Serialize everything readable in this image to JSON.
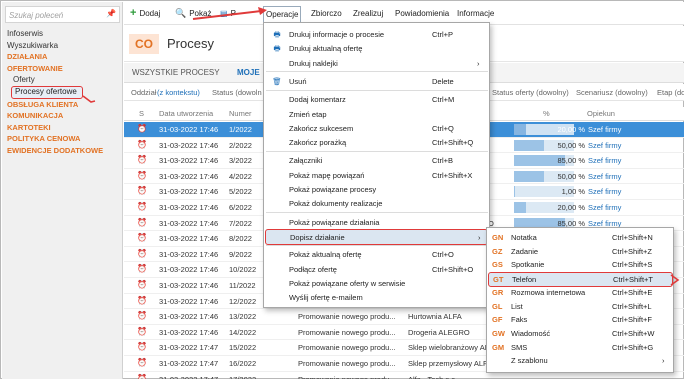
{
  "sidebar": {
    "search_placeholder": "Szukaj poleceń",
    "items": [
      {
        "label": "Infoserwis",
        "kind": "plain"
      },
      {
        "label": "Wyszukiwarka",
        "kind": "plain"
      },
      {
        "label": "DZIAŁANIA",
        "kind": "section"
      },
      {
        "label": "OFERTOWANIE",
        "kind": "section"
      },
      {
        "label": "Oferty",
        "kind": "sub"
      },
      {
        "label": "Procesy ofertowe",
        "kind": "active"
      },
      {
        "label": "OBSŁUGA KLIENTA",
        "kind": "section"
      },
      {
        "label": "KOMUNIKACJA",
        "kind": "section"
      },
      {
        "label": "KARTOTEKI",
        "kind": "section"
      },
      {
        "label": "POLITYKA CENOWA",
        "kind": "section"
      },
      {
        "label": "EWIDENCJE DODATKOWE",
        "kind": "section"
      }
    ]
  },
  "toolbar": {
    "add_label": "Dodaj",
    "show_label": "Pokaż",
    "partial_label": "P",
    "menus": [
      "Operacje",
      "Zbiorczo",
      "Zrealizuj",
      "Powiadomienia",
      "Informacje"
    ]
  },
  "header": {
    "badge": "CO",
    "title": "Procesy"
  },
  "tabs": {
    "all": "WSZYSTKIE PROCESY",
    "mine": "MOJE"
  },
  "filters": {
    "department": "Oddział",
    "context": "(z kontekstu)",
    "status": "Status (dowoln",
    "offer_status": "Status oferty (dowolny)",
    "scenario": "Scenariusz (dowolny)",
    "stage": "Etap (do"
  },
  "grid": {
    "columns": {
      "s": "S",
      "date": "Data utworzenia",
      "number": "Numer",
      "percent": "%",
      "caretaker": "Opiekun"
    },
    "rows": [
      {
        "date": "31-03-2022 17:46",
        "number": "1/2022",
        "desc": "",
        "client": "",
        "percent": "20,00 %",
        "progress": 0.2,
        "opiekun": "Szef firmy",
        "selected": true
      },
      {
        "date": "31-03-2022 17:46",
        "number": "2/2022",
        "desc": "",
        "client": "",
        "percent": "50,00 %",
        "progress": 0.5,
        "opiekun": "Szef firmy",
        "selected": false
      },
      {
        "date": "31-03-2022 17:46",
        "number": "3/2022",
        "desc": "",
        "client": "",
        "percent": "85,00 %",
        "progress": 0.85,
        "opiekun": "Szef firmy",
        "selected": false
      },
      {
        "date": "31-03-2022 17:46",
        "number": "4/2022",
        "desc": "",
        "client": "",
        "percent": "50,00 %",
        "progress": 0.5,
        "opiekun": "Szef firmy",
        "selected": false
      },
      {
        "date": "31-03-2022 17:46",
        "number": "5/2022",
        "desc": "",
        "client": "",
        "percent": "1,00 %",
        "progress": 0.01,
        "opiekun": "Szef firmy",
        "selected": false
      },
      {
        "date": "31-03-2022 17:46",
        "number": "6/2022",
        "desc": "",
        "client": "",
        "percent": "20,00 %",
        "progress": 0.2,
        "opiekun": "Szef firmy",
        "selected": false
      },
      {
        "date": "31-03-2022 17:46",
        "number": "7/2022",
        "desc": "",
        "client": "O",
        "percent": "85,00 %",
        "progress": 0.85,
        "opiekun": "Szef firmy",
        "selected": false
      },
      {
        "date": "31-03-2022 17:46",
        "number": "8/2022",
        "desc": "",
        "client": "",
        "percent": "",
        "progress": null,
        "opiekun": "",
        "selected": false
      },
      {
        "date": "31-03-2022 17:46",
        "number": "9/2022",
        "desc": "",
        "client": "",
        "percent": "",
        "progress": null,
        "opiekun": "",
        "selected": false
      },
      {
        "date": "31-03-2022 17:46",
        "number": "10/2022",
        "desc": "",
        "client": "",
        "percent": "",
        "progress": null,
        "opiekun": "",
        "selected": false
      },
      {
        "date": "31-03-2022 17:46",
        "number": "11/2022",
        "desc": "",
        "client": "",
        "percent": "",
        "progress": null,
        "opiekun": "",
        "selected": false
      },
      {
        "date": "31-03-2022 17:46",
        "number": "12/2022",
        "desc": "",
        "client": "",
        "percent": "",
        "progress": null,
        "opiekun": "",
        "selected": false
      },
      {
        "date": "31-03-2022 17:46",
        "number": "13/2022",
        "desc": "Promowanie nowego produ...",
        "client": "Hurtownia ALFA",
        "percent": "",
        "progress": null,
        "opiekun": "",
        "selected": false
      },
      {
        "date": "31-03-2022 17:46",
        "number": "14/2022",
        "desc": "Promowanie nowego produ...",
        "client": "Drogeria ALEGRO",
        "percent": "",
        "progress": null,
        "opiekun": "",
        "selected": false
      },
      {
        "date": "31-03-2022 17:47",
        "number": "15/2022",
        "desc": "Promowanie nowego produ...",
        "client": "Sklep wielobranżowy ALFA",
        "percent": "",
        "progress": null,
        "opiekun": "",
        "selected": false
      },
      {
        "date": "31-03-2022 17:47",
        "number": "16/2022",
        "desc": "Promowanie nowego produ...",
        "client": "Sklep przemysłowy ALFA",
        "percent": "",
        "progress": null,
        "opiekun": "",
        "selected": false
      },
      {
        "date": "31-03-2022 17:47",
        "number": "17/2022",
        "desc": "Promowanie nowego produ...",
        "client": "Alfa - Tech s.c.",
        "percent": "",
        "progress": null,
        "opiekun": "",
        "selected": false
      }
    ]
  },
  "operations_menu": {
    "items": [
      {
        "icon": "printer-icon",
        "glyph": "🖶",
        "label": "Drukuj informacje o procesie",
        "shortcut": "Ctrl+P"
      },
      {
        "icon": "printer-icon",
        "glyph": "🖶",
        "label": "Drukuj aktualną ofertę",
        "shortcut": ""
      },
      {
        "icon": "",
        "glyph": "",
        "label": "Drukuj naklejki",
        "shortcut": "",
        "submenu": true
      },
      {
        "sep": true
      },
      {
        "icon": "trash-icon",
        "glyph": "🗑",
        "label": "Usuń",
        "shortcut": "Delete"
      },
      {
        "sep": true
      },
      {
        "label": "Dodaj komentarz",
        "shortcut": "Ctrl+M"
      },
      {
        "label": "Zmień etap",
        "shortcut": ""
      },
      {
        "label": "Zakończ sukcesem",
        "shortcut": "Ctrl+Q"
      },
      {
        "label": "Zakończ porażką",
        "shortcut": "Ctrl+Shift+Q"
      },
      {
        "sep": true
      },
      {
        "label": "Załączniki",
        "shortcut": "Ctrl+B"
      },
      {
        "label": "Pokaż mapę powiązań",
        "shortcut": "Ctrl+Shift+X"
      },
      {
        "label": "Pokaż powiązane procesy",
        "shortcut": ""
      },
      {
        "label": "Pokaż dokumenty realizacje",
        "shortcut": ""
      },
      {
        "sep": true
      },
      {
        "label": "Pokaż powiązane działania",
        "shortcut": ""
      },
      {
        "label": "Dopisz działanie",
        "shortcut": "",
        "submenu": true,
        "highlight": true
      },
      {
        "sep": true
      },
      {
        "label": "Pokaż aktualną ofertę",
        "shortcut": "Ctrl+O"
      },
      {
        "label": "Podłącz ofertę",
        "shortcut": "Ctrl+Shift+O"
      },
      {
        "label": "Pokaż powiązane oferty w serwisie",
        "shortcut": ""
      },
      {
        "label": "Wyślij ofertę e-mailem",
        "shortcut": ""
      }
    ]
  },
  "action_submenu": {
    "items": [
      {
        "code": "GN",
        "label": "Notatka",
        "shortcut": "Ctrl+Shift+N"
      },
      {
        "code": "GZ",
        "label": "Zadanie",
        "shortcut": "Ctrl+Shift+Z"
      },
      {
        "code": "GS",
        "label": "Spotkanie",
        "shortcut": "Ctrl+Shift+S"
      },
      {
        "code": "GT",
        "label": "Telefon",
        "shortcut": "Ctrl+Shift+T",
        "highlight": true
      },
      {
        "code": "GR",
        "label": "Rozmowa internetowa",
        "shortcut": "Ctrl+Shift+E"
      },
      {
        "code": "GL",
        "label": "List",
        "shortcut": "Ctrl+Shift+L"
      },
      {
        "code": "GF",
        "label": "Faks",
        "shortcut": "Ctrl+Shift+F"
      },
      {
        "code": "GW",
        "label": "Wiadomość",
        "shortcut": "Ctrl+Shift+W"
      },
      {
        "code": "GM",
        "label": "SMS",
        "shortcut": "Ctrl+Shift+G"
      },
      {
        "code": "",
        "label": "Z szablonu",
        "shortcut": "",
        "submenu": true
      }
    ]
  },
  "colors": {
    "accent": "#e27224",
    "selection": "#3c8fd8",
    "link": "#1e6fb8",
    "highlight_border": "#e03a3a"
  }
}
